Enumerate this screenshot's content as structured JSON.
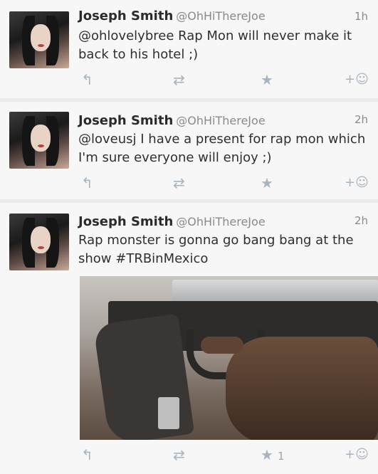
{
  "tweets": [
    {
      "name": "Joseph Smith",
      "handle": "@OhHiThereJoe",
      "time": "1h",
      "text": "@ohlovelybree Rap Mon will never make it back to his hotel ;)"
    },
    {
      "name": "Joseph Smith",
      "handle": "@OhHiThereJoe",
      "time": "2h",
      "text": "@loveusj I have a present for rap mon which I'm sure everyone will enjoy ;)"
    },
    {
      "name": "Joseph Smith",
      "handle": "@OhHiThereJoe",
      "time": "2h",
      "text": "Rap monster is gonna go bang bang at the show #TRBinMexico",
      "favorite_count": "1"
    }
  ],
  "icons": {
    "reply": "reply-icon",
    "retweet": "retweet-icon",
    "favorite": "star-icon",
    "follow": "follow-icon"
  },
  "colors": {
    "action_icon": "#a8b4bf",
    "muted_text": "#8a8a8a",
    "background": "#f7f7f7"
  }
}
